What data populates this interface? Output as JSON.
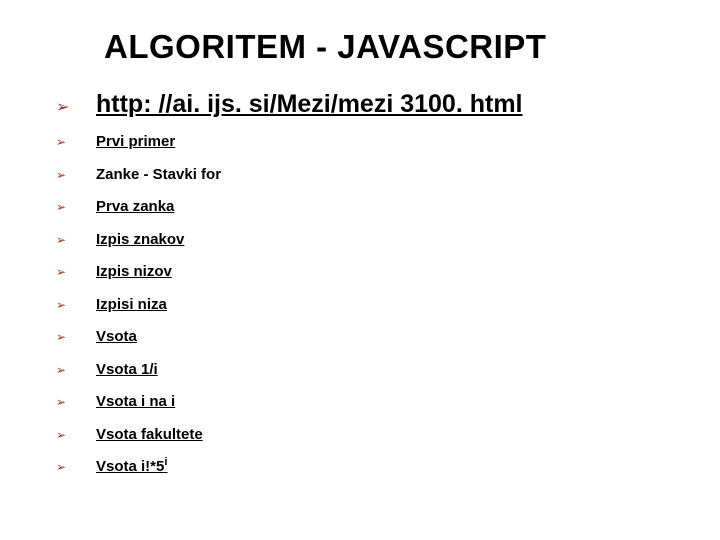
{
  "title": "ALGORITEM - JAVASCRIPT",
  "items": [
    {
      "text": "http: //ai. ijs. si/Mezi/mezi 3100. html",
      "big": true,
      "link": true
    },
    {
      "text": "Prvi primer",
      "link": true
    },
    {
      "text": "Zanke - Stavki for",
      "link": false
    },
    {
      "text": "Prva zanka",
      "link": true
    },
    {
      "text": "Izpis znakov",
      "link": true
    },
    {
      "text": "Izpis nizov",
      "link": true
    },
    {
      "text": "Izpisi niza",
      "link": true
    },
    {
      "text": "Vsota",
      "link": true
    },
    {
      "text": "Vsota 1/i",
      "link": true
    },
    {
      "text": "Vsota i na i",
      "link": true
    },
    {
      "text": "Vsota fakultete",
      "link": true
    },
    {
      "text": "Vsota i!*5",
      "sup": "i",
      "link": true
    }
  ]
}
